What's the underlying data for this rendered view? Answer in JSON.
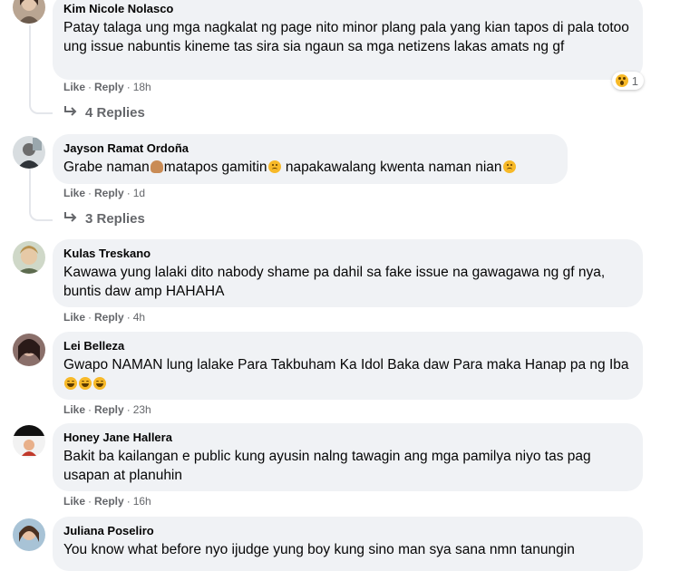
{
  "actions": {
    "like": "Like",
    "reply": "Reply",
    "sep": "·"
  },
  "comments": [
    {
      "name": "Kim Nicole Nolasco",
      "text": "Patay talaga ung mga nagkalat ng page nito minor plang pala yang kian tapos di pala totoo ung issue nabuntis kineme tas sira sia ngaun sa mga netizens lakas amats ng gf",
      "time": "18h",
      "replies": "4 Replies",
      "reaction_count": "1",
      "reaction_icon": "wow-emoji-icon"
    },
    {
      "name": "Jayson Ramat Ordoña",
      "text_parts": [
        "Grabe naman",
        "matapos gamitin",
        " napakawalang kwenta naman nian"
      ],
      "time": "1d",
      "replies": "3 Replies"
    },
    {
      "name": "Kulas Treskano",
      "text": "Kawawa yung lalaki dito nabody shame pa dahil sa fake issue na gawagawa ng gf nya, buntis daw amp HAHAHA",
      "time": "4h"
    },
    {
      "name": "Lei Belleza",
      "text": "Gwapo NAMAN lung lalake Para Takbuham Ka Idol Baka daw Para maka Hanap pa ng Iba",
      "time": "23h"
    },
    {
      "name": "Honey Jane Hallera",
      "text": "Bakit ba kailangan e public kung ayusin nalng tawagin ang mga pamilya niyo tas pag usapan at planuhin",
      "time": "16h"
    },
    {
      "name": "Juliana Poseliro",
      "text": "You know what before nyo ijudge yung boy kung sino man sya sana nmn tanungin"
    }
  ],
  "colors": {
    "bubble": "#f0f2f5",
    "meta": "#65676b",
    "thread": "#e4e6eb"
  }
}
